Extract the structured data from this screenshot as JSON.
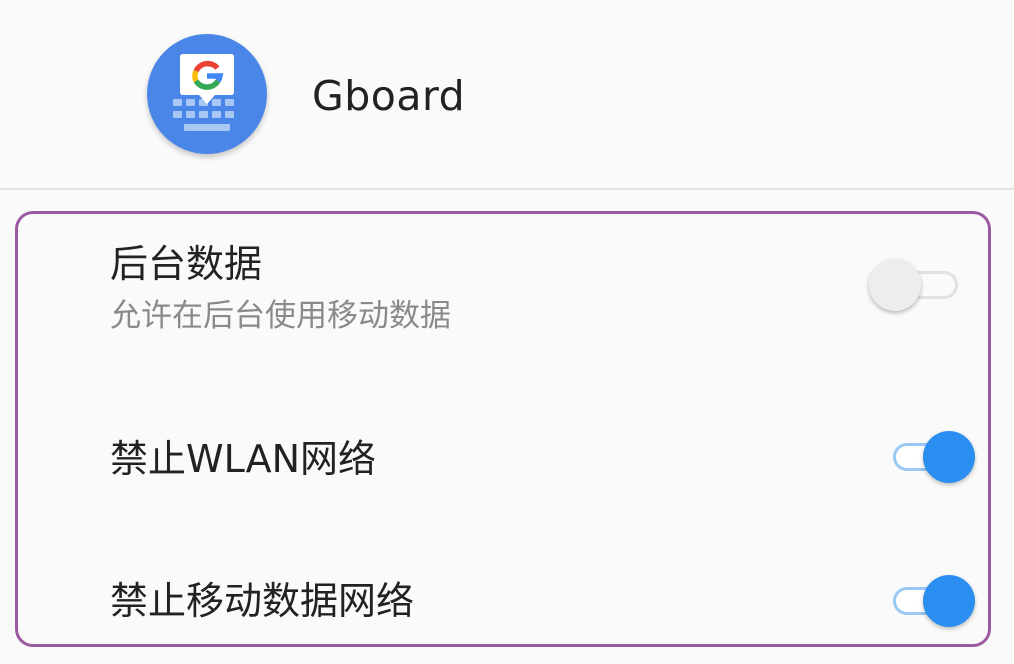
{
  "app": {
    "name": "Gboard",
    "icon": "gboard-icon",
    "icon_letter": "G"
  },
  "settings": [
    {
      "title": "后台数据",
      "subtitle": "允许在后台使用移动数据",
      "enabled": false
    },
    {
      "title": "禁止WLAN网络",
      "enabled": true
    },
    {
      "title": "禁止移动数据网络",
      "enabled": true
    }
  ],
  "colors": {
    "accent": "#2a8ff0",
    "highlight_border": "#9c5aa3",
    "icon_background": "#4a86e8"
  }
}
